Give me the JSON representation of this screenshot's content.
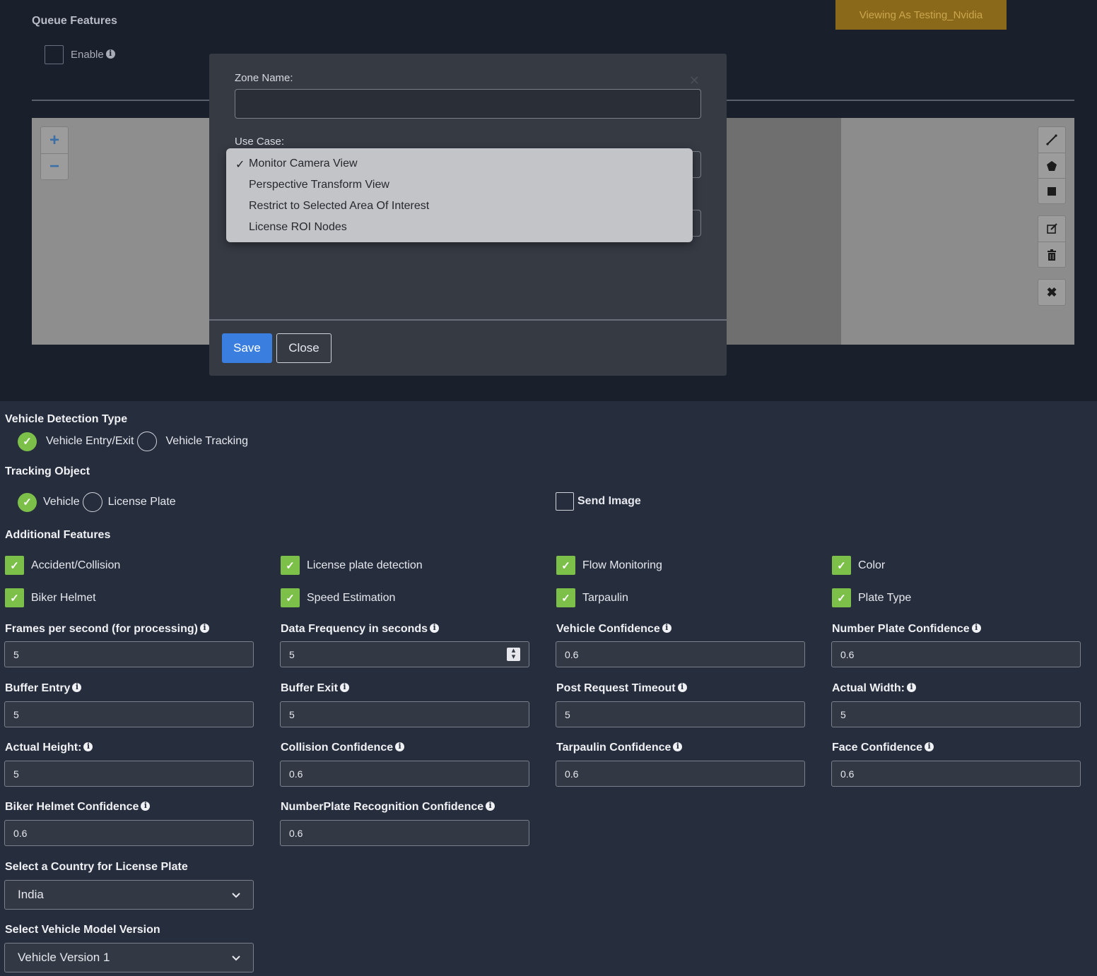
{
  "header": {
    "queue_title": "Queue Features",
    "enable_label": "Enable",
    "viewing_badge": "Viewing As Testing_Nvidia"
  },
  "canvas_tools": {
    "zoom_in": "+",
    "zoom_out": "−",
    "icons": [
      "line-icon",
      "polygon-icon",
      "square-icon",
      "edit-icon",
      "trash-icon",
      "close-icon"
    ]
  },
  "modal": {
    "zone_name_label": "Zone Name:",
    "zone_name_value": "",
    "use_case_label": "Use Case:",
    "save_label": "Save",
    "close_label": "Close",
    "use_case_options": [
      {
        "label": "Monitor Camera View",
        "checked": true
      },
      {
        "label": "Perspective Transform View",
        "checked": false
      },
      {
        "label": "Restrict to Selected Area Of Interest",
        "checked": false
      },
      {
        "label": "License ROI Nodes",
        "checked": false
      }
    ]
  },
  "form": {
    "vehicle_detection_type": {
      "title": "Vehicle Detection Type",
      "options": [
        {
          "label": "Vehicle Entry/Exit",
          "selected": true
        },
        {
          "label": "Vehicle Tracking",
          "selected": false
        }
      ]
    },
    "tracking_object": {
      "title": "Tracking Object",
      "options": [
        {
          "label": "Vehicle",
          "selected": true
        },
        {
          "label": "License Plate",
          "selected": false
        }
      ],
      "send_image_label": "Send Image",
      "send_image_checked": false
    },
    "additional_features": {
      "title": "Additional Features",
      "items": [
        {
          "label": "Accident/Collision",
          "checked": true
        },
        {
          "label": "License plate detection",
          "checked": true
        },
        {
          "label": "Flow Monitoring",
          "checked": true
        },
        {
          "label": "Color",
          "checked": true
        },
        {
          "label": "Biker Helmet",
          "checked": true
        },
        {
          "label": "Speed Estimation",
          "checked": true
        },
        {
          "label": "Tarpaulin",
          "checked": true
        },
        {
          "label": "Plate Type",
          "checked": true
        }
      ]
    },
    "fields": [
      {
        "label": "Frames per second (for processing)",
        "value": "5"
      },
      {
        "label": "Data Frequency in seconds",
        "value": "5"
      },
      {
        "label": "Vehicle Confidence",
        "value": "0.6"
      },
      {
        "label": "Number Plate Confidence",
        "value": "0.6"
      },
      {
        "label": "Buffer Entry",
        "value": "5"
      },
      {
        "label": "Buffer Exit",
        "value": "5"
      },
      {
        "label": "Post Request Timeout",
        "value": "5"
      },
      {
        "label": "Actual Width:",
        "value": "5"
      },
      {
        "label": "Actual Height:",
        "value": "5"
      },
      {
        "label": "Collision Confidence",
        "value": "0.6"
      },
      {
        "label": "Tarpaulin Confidence",
        "value": "0.6"
      },
      {
        "label": "Face Confidence",
        "value": "0.6"
      },
      {
        "label": "Biker Helmet Confidence",
        "value": "0.6"
      },
      {
        "label": "NumberPlate Recognition Confidence",
        "value": "0.6"
      }
    ],
    "country": {
      "label": "Select a Country for License Plate",
      "selected": "India"
    },
    "vehicle_model": {
      "label": "Select Vehicle Model Version",
      "selected": "Vehicle Version 1"
    }
  },
  "colors": {
    "accent_green": "#7cc04a",
    "save_blue": "#3a7fe0",
    "badge_gold": "#8a6a1a"
  }
}
